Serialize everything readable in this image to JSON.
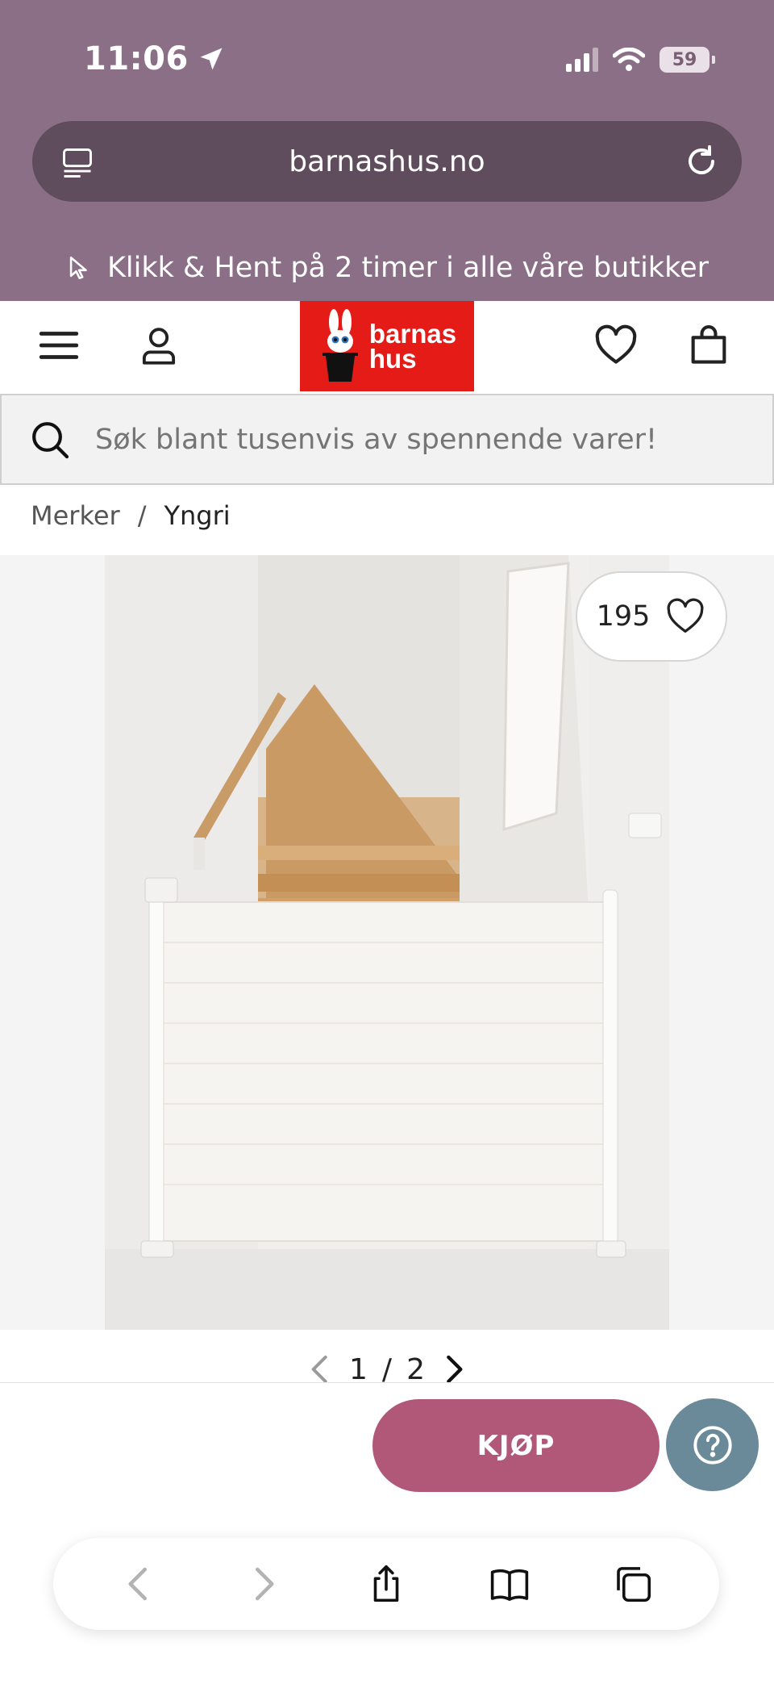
{
  "status_bar": {
    "time": "11:06",
    "battery": "59"
  },
  "browser": {
    "url": "barnashus.no"
  },
  "promo": {
    "text": "Klikk & Hent på 2 timer i alle våre butikker"
  },
  "logo": {
    "line1": "barnas",
    "line2": "hus",
    "bg_color": "#e41b17"
  },
  "search": {
    "placeholder": "Søk blant tusenvis av spennende varer!"
  },
  "breadcrumb": {
    "items": [
      "Merker",
      "Yngri"
    ],
    "separator": "/"
  },
  "product": {
    "like_count": "195",
    "pager": {
      "current": "1",
      "separator": "/",
      "total": "2"
    },
    "buy_label": "KJØP"
  },
  "colors": {
    "top_bar": "#8b6f86",
    "url_bar": "#5f4c5c",
    "buy": "#b15878",
    "help": "#6a8a99"
  },
  "icons": [
    "location-arrow-icon",
    "signal-icon",
    "wifi-icon",
    "reader-icon",
    "reload-icon",
    "cursor-icon",
    "menu-icon",
    "user-icon",
    "heart-icon",
    "bag-icon",
    "search-icon",
    "chevron-left-icon",
    "chevron-right-icon",
    "help-icon",
    "back-icon",
    "forward-icon",
    "share-icon",
    "bookmarks-icon",
    "tabs-icon"
  ]
}
